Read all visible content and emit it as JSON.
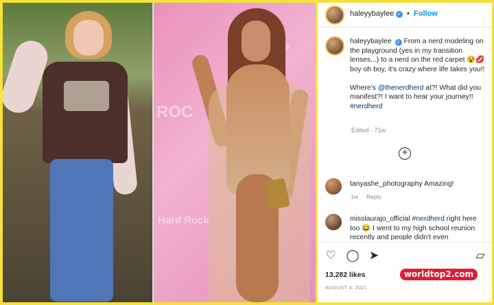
{
  "post": {
    "username": "haleyybaylee",
    "follow_label": "Follow",
    "caption_user": "haleyybaylee",
    "caption_text_1": "From a nerd modeling on the playground (yes in my transition lenses...) to a nerd on the red carpet 😵💋 boy oh boy, it's crazy where life takes you!!",
    "caption_text_2_prefix": "Where's",
    "caption_mention": "@thenerdherd",
    "caption_text_2_suffix": "at?! What did you manifest?! I want to hear your journey!!",
    "caption_hashtag": "#nerdherd",
    "edited_meta": "Edited · 71w",
    "likes": "13,282 likes",
    "date": "AUGUST 4, 2021"
  },
  "comments": [
    {
      "user": "tanyashe_photography",
      "text": "Amazing!",
      "age": "1w",
      "reply": "Reply"
    },
    {
      "user": "misslaurajo_official",
      "hashtag": "#nerdherd",
      "text": "right here too 😂 I went to my high school reunion recently and people didn't even"
    }
  ],
  "watermark": "worldtop2.com",
  "backdrop": {
    "roc": "ROC",
    "app": "App",
    "hard_rock": "Hard Rock"
  },
  "icons": {
    "follow": "verified-icon",
    "add_comments": "plus-circle-icon",
    "like": "heart-icon",
    "comment": "comment-icon",
    "share": "paper-plane-icon",
    "save": "bookmark-icon"
  }
}
